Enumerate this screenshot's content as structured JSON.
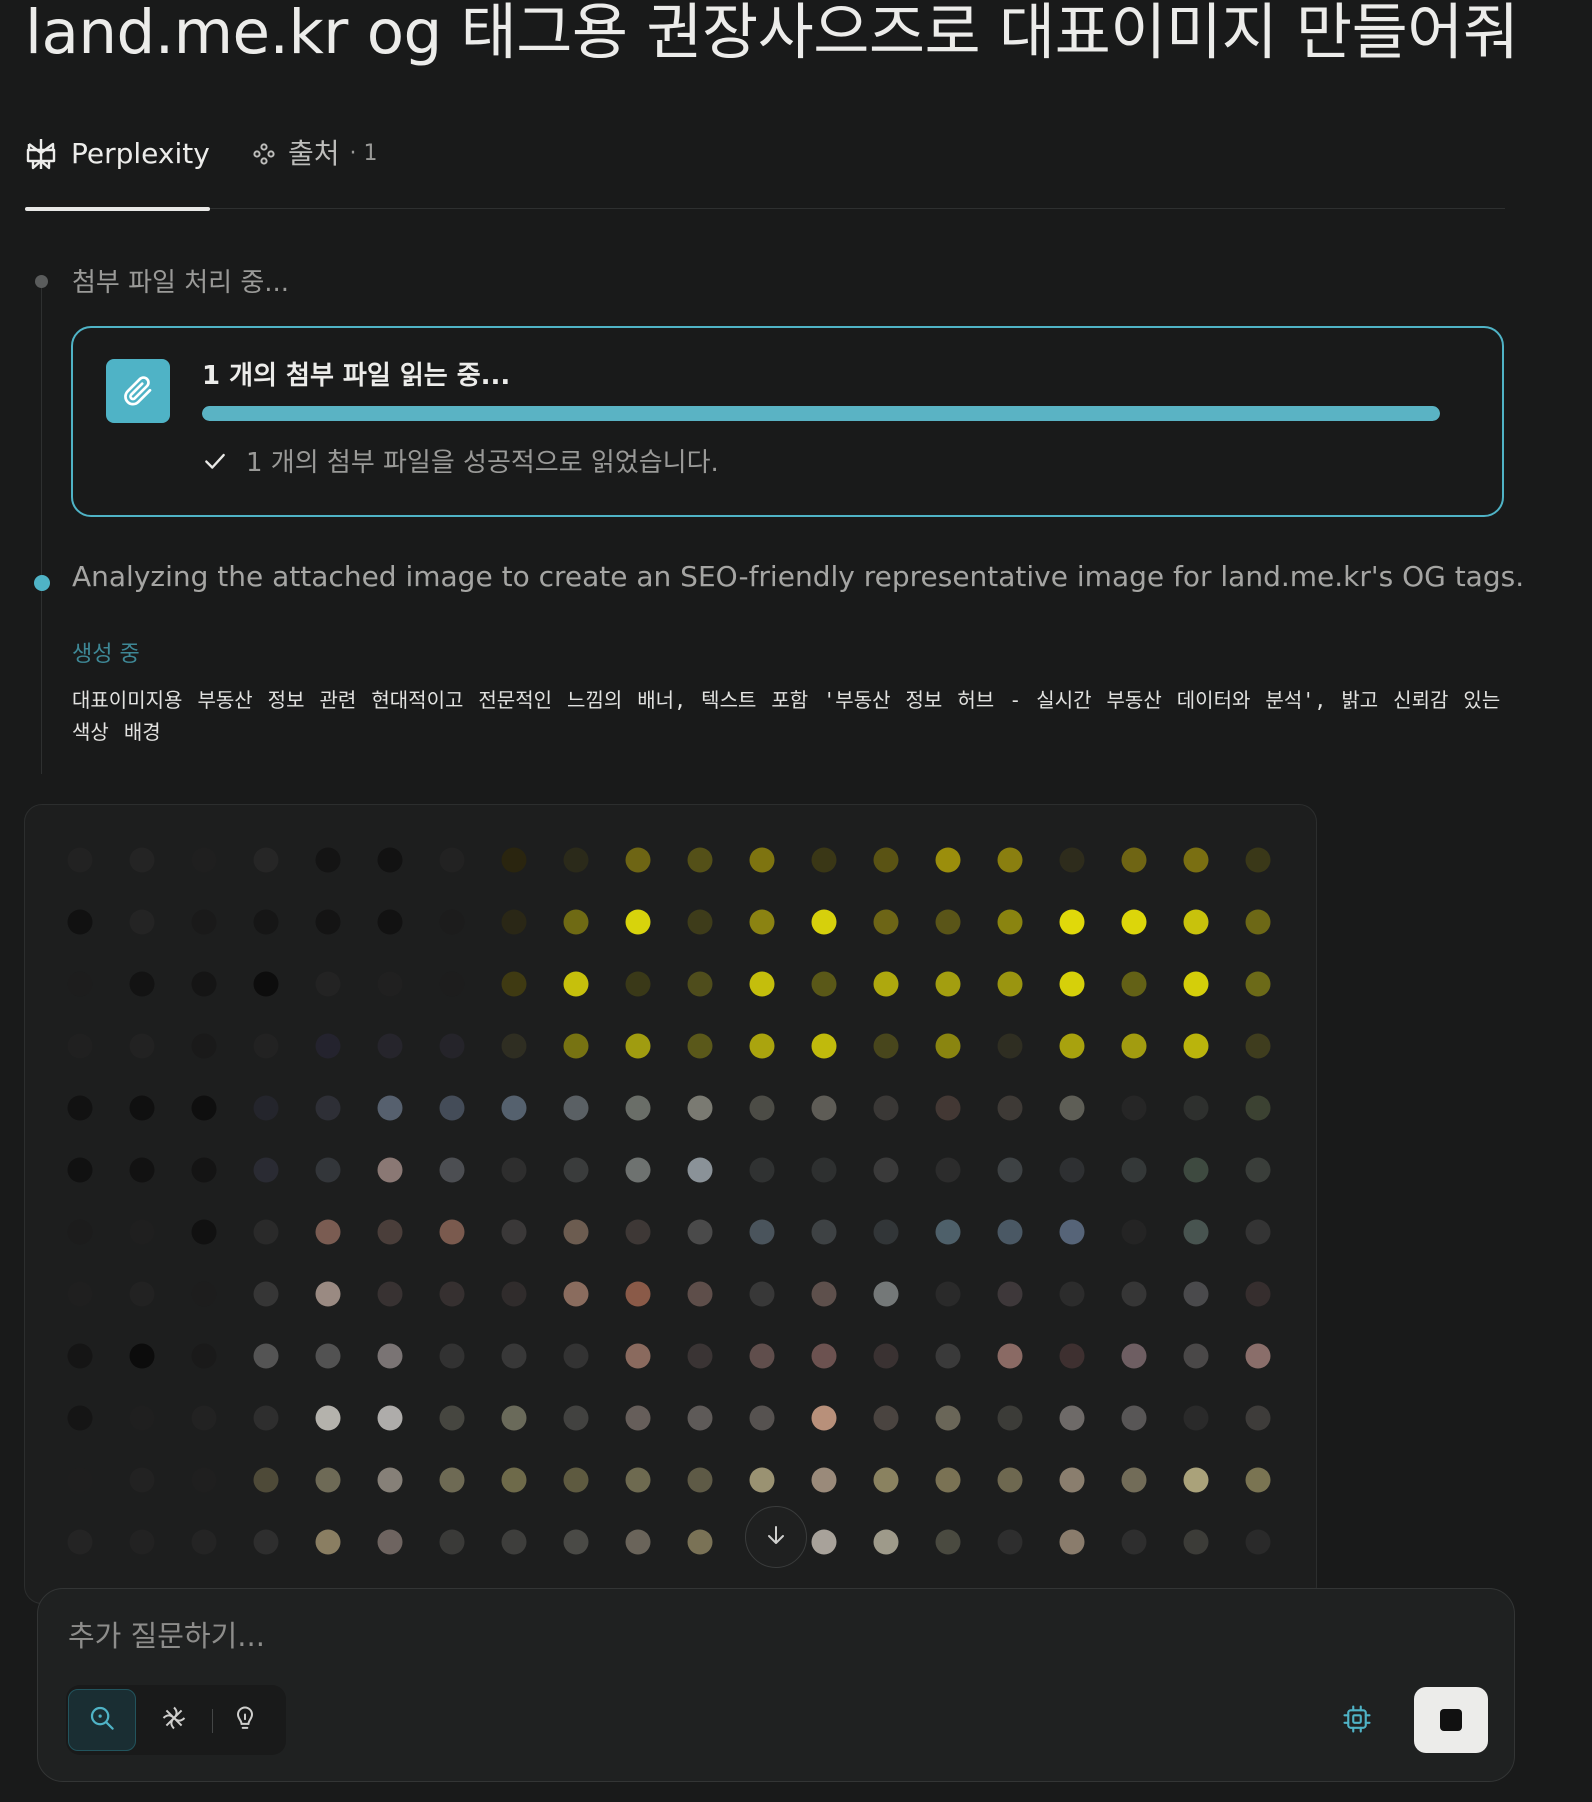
{
  "page_title": "land.me.kr og 태그용 권장사으즈로 대표이미지 만들어줘",
  "tabs": {
    "perplexity": {
      "label": "Perplexity",
      "icon": "perplexity-logo-icon"
    },
    "sources": {
      "label": "출처",
      "count": "· 1",
      "icon": "sources-icon"
    }
  },
  "steps": {
    "processing": "첨부 파일 처리 중...",
    "attachment": {
      "title": "1 개의 첨부 파일 읽는 중...",
      "progress": 1.0,
      "result": "1 개의 첨부 파일을 성공적으로 읽었습니다."
    },
    "analyzing": "Analyzing the attached image to create an SEO-friendly representative image for land.me.kr's OG tags.",
    "generating_label": "생성 중",
    "prompt": "대표이미지용 부동산 정보 관련 현대적이고 전문적인 느낌의 배너, 텍스트 포함 '부동산 정보 허브 - 실시간 부동산 데이터와 분석', 밝고 신뢰감 있는 색상 배경"
  },
  "image_preview": {
    "status": "generating",
    "dot_colors": [
      [
        "#222",
        "#242424",
        "#1f1f1f",
        "#262626",
        "#141414",
        "#121212",
        "#222",
        "#2a250f",
        "#2b2a1a",
        "#6e6514",
        "#545018",
        "#7e7410",
        "#3a3716",
        "#5a5314",
        "#9b8e0c",
        "#8a7f10",
        "#2e2c1c",
        "#6f6514",
        "#7a6f12",
        "#3a3818"
      ],
      [
        "#111",
        "#242424",
        "#1a1a1a",
        "#161616",
        "#141414",
        "#121212",
        "#1c1c1c",
        "#2a2716",
        "#6f6a14",
        "#d7d30c",
        "#3e3c1a",
        "#8b8312",
        "#d6d00c",
        "#6d6516",
        "#5a5518",
        "#8a8410",
        "#e0d90a",
        "#dcd60a",
        "#c8c20c",
        "#6d6816"
      ],
      [
        "#1d1d1d",
        "#131313",
        "#151515",
        "#0d0d0d",
        "#232323",
        "#202020",
        "#1d1d1d",
        "#3f3a12",
        "#c6c00c",
        "#3a3918",
        "#4f4d1c",
        "#c4be0c",
        "#5a5818",
        "#aea80e",
        "#a39e10",
        "#9a9510",
        "#d6d00a",
        "#636116",
        "#d4ce0a",
        "#6c6a18"
      ],
      [
        "#202020",
        "#222",
        "#1a1a1a",
        "#222",
        "#24232e",
        "#26252c",
        "#25242a",
        "#2f2e22",
        "#777312",
        "#a09c10",
        "#5a581a",
        "#aaa40e",
        "#c0ba0c",
        "#48461c",
        "#8a8510",
        "#2f2e22",
        "#a8a20e",
        "#a29c10",
        "#bab40c",
        "#3f3d1e"
      ],
      [
        "#121212",
        "#101010",
        "#0f0f0f",
        "#24252c",
        "#2e2f36",
        "#56606e",
        "#444c58",
        "#55616e",
        "#5a6064",
        "#6a6e68",
        "#7a7a72",
        "#4c4c46",
        "#5e5c56",
        "#3a3836",
        "#433834",
        "#3e3a36",
        "#5e5e56",
        "#262626",
        "#2e302e",
        "#3c4232"
      ],
      [
        "#111",
        "#121212",
        "#141414",
        "#2a2b33",
        "#33363a",
        "#8a7874",
        "#4c4e52",
        "#2e2e2e",
        "#3a3c3c",
        "#6e7270",
        "#8a9298",
        "#303232",
        "#2e3030",
        "#3a3a3a",
        "#2c2c2c",
        "#3e4244",
        "#2e3032",
        "#343838",
        "#3e4a40",
        "#3a3e3a"
      ],
      [
        "#1c1c1c",
        "#1f1f1f",
        "#111",
        "#2a2a2a",
        "#7a5c52",
        "#4a3e3a",
        "#7a5a4e",
        "#3a3838",
        "#6c5c50",
        "#3e3836",
        "#4a4a4a",
        "#4a545c",
        "#3e4244",
        "#323638",
        "#4e606a",
        "#4a5864",
        "#566478",
        "#242424",
        "#485450",
        "#343434"
      ],
      [
        "#1f1f1f",
        "#222",
        "#1d1d1d",
        "#363636",
        "#9a8a82",
        "#383232",
        "#363030",
        "#302c2c",
        "#8a6c5e",
        "#8a5a48",
        "#5e4e4a",
        "#383838",
        "#5e504c",
        "#747878",
        "#2a2a2a",
        "#3e383a",
        "#2c2c2c",
        "#363636",
        "#4a4a4c",
        "#362e2e"
      ],
      [
        "#151515",
        "#0c0c0c",
        "#1a1a1a",
        "#545454",
        "#525252",
        "#7a7474",
        "#323232",
        "#383838",
        "#333333",
        "#8a6a5e",
        "#3a3434",
        "#604e4c",
        "#6c5250",
        "#3a3232",
        "#3a3a3a",
        "#8a6a64",
        "#3e3030",
        "#6e5e62",
        "#4a4848",
        "#8a6e6a"
      ],
      [
        "#151515",
        "#1f1f1f",
        "#222",
        "#2e2e2e",
        "#b4b2ac",
        "#aeacaa",
        "#464640",
        "#6a6a5a",
        "#424240",
        "#665e5a",
        "#5e5a58",
        "#565250",
        "#b8907a",
        "#4a4440",
        "#6a6658",
        "#3c3c38",
        "#6e6a68",
        "#585656",
        "#2a2a2a",
        "#3e3c3a"
      ],
      [
        "#1e1e1e",
        "#222",
        "#1f1f1f",
        "#4e4a38",
        "#6e6a56",
        "#868078",
        "#6e6a54",
        "#6e6a4a",
        "#5e5a40",
        "#6e6a50",
        "#5e5a46",
        "#9a9272",
        "#9a8a7a",
        "#8a8260",
        "#7a7254",
        "#6e6850",
        "#8a7e6e",
        "#726c58",
        "#aaa27a",
        "#7a7452"
      ],
      [
        "#242424",
        "#222",
        "#242424",
        "#2e2e2e",
        "#8a7e62",
        "#6e6460",
        "#3a3a38",
        "#3e3e3c",
        "#4a4a46",
        "#6a645a",
        "#7a7256",
        "#2a2a2a",
        "#a8a29a",
        "#9e9a8a",
        "#4a4a40",
        "#2e2e2e",
        "#8a7c6c",
        "#2e2e2e",
        "#3c3c38",
        "#2a2a2a"
      ]
    ]
  },
  "scroll_down": {
    "icon": "arrow-down-icon"
  },
  "ask": {
    "placeholder": "추가 질문하기...",
    "modes": [
      "search-icon",
      "research-icon",
      "labs-icon"
    ],
    "model_icon": "chip-icon",
    "stop_icon": "stop-icon"
  },
  "colors": {
    "background": "#191a1a",
    "accent": "#4fb3c6",
    "text_primary": "#ececea",
    "text_muted": "#9a9a98"
  }
}
